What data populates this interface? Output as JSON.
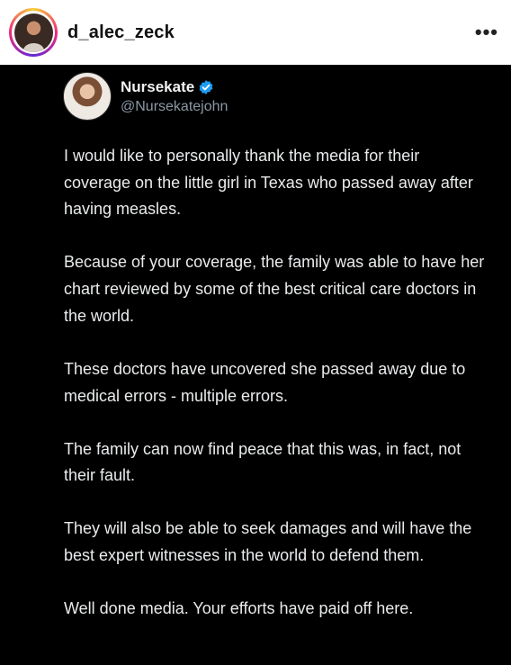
{
  "post": {
    "username": "d_alec_zeck",
    "more_icon": "more-horizontal-icon"
  },
  "tweet": {
    "display_name": "Nursekate",
    "handle": "@Nursekatejohn",
    "verified_color": "#1d9bf0",
    "paragraphs": [
      "I would like to personally thank the media for their coverage on the little girl in Texas who passed away after having measles.",
      "Because of your coverage, the family was able to have her chart reviewed by some of the best critical care doctors in the world.",
      "These doctors have uncovered she passed away due to medical errors - multiple errors.",
      "The family can now find peace that this was, in fact, not their fault.",
      "They will also be able to seek damages and will have the best expert witnesses in the world to defend them.",
      "Well done media. Your efforts have paid off here."
    ]
  }
}
